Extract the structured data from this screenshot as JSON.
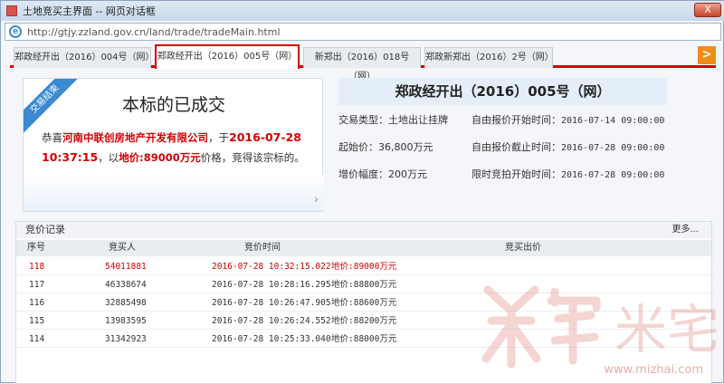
{
  "window": {
    "title": "土地竞买主界面 -- 网页对话框",
    "close_label": "X"
  },
  "address": {
    "url": "http://gtjy.zzland.gov.cn/land/trade/tradeMain.html"
  },
  "tabs": [
    {
      "label": "郑政经开出（2016）004号（网）"
    },
    {
      "label": "郑政经开出（2016）005号（网）"
    },
    {
      "label": "新郑出（2016）018号（网）"
    },
    {
      "label": "郑政新郑出（2016）2号（网）"
    }
  ],
  "tab_next": ">",
  "result": {
    "ribbon": "交易结束",
    "heading": "本标的已成交",
    "p1": "恭喜",
    "winner": "河南中联创房地产开发有限公司",
    "p2": "，于",
    "time": "2016-07-28 10:37:15",
    "p3": "，以",
    "price": "地价:89000万元",
    "p4": "价格，竞得该宗标的。",
    "arrow": "›"
  },
  "detail": {
    "title": "郑政经开出（2016）005号（网）",
    "rows": [
      {
        "left": "交易类型：土地出让挂牌",
        "right_label": "自由报价开始时间：",
        "right_value": "2016-07-14 09:00:00"
      },
      {
        "left": "起始价：36,800万元",
        "right_label": "自由报价截止时间：",
        "right_value": "2016-07-28 09:00:00"
      },
      {
        "left": "增价幅度：200万元",
        "right_label": "限时竞拍开始时间：",
        "right_value": "2016-07-28 09:00:00"
      }
    ]
  },
  "bids": {
    "title": "竞价记录",
    "more": "更多...",
    "columns": [
      "序号",
      "竞买人",
      "竞价时间",
      "竞买出价"
    ],
    "rows": [
      {
        "no": "118",
        "bidder": "54011881",
        "time": "2016-07-28 10:32:15.022",
        "price": "地价:89000万元"
      },
      {
        "no": "117",
        "bidder": "46338674",
        "time": "2016-07-28 10:28:16.295",
        "price": "地价:88800万元"
      },
      {
        "no": "116",
        "bidder": "32885498",
        "time": "2016-07-28 10:26:47.905",
        "price": "地价:88600万元"
      },
      {
        "no": "115",
        "bidder": "13983595",
        "time": "2016-07-28 10:26:24.552",
        "price": "地价:88200万元"
      },
      {
        "no": "114",
        "bidder": "31342923",
        "time": "2016-07-28 10:25:33.040",
        "price": "地价:88000万元"
      }
    ]
  },
  "watermark": {
    "text": "米宅",
    "url": "www.mizhai.com"
  },
  "colors": {
    "accent": "#d40000",
    "blue": "#3a89d1",
    "orange": "#f08c1b"
  }
}
